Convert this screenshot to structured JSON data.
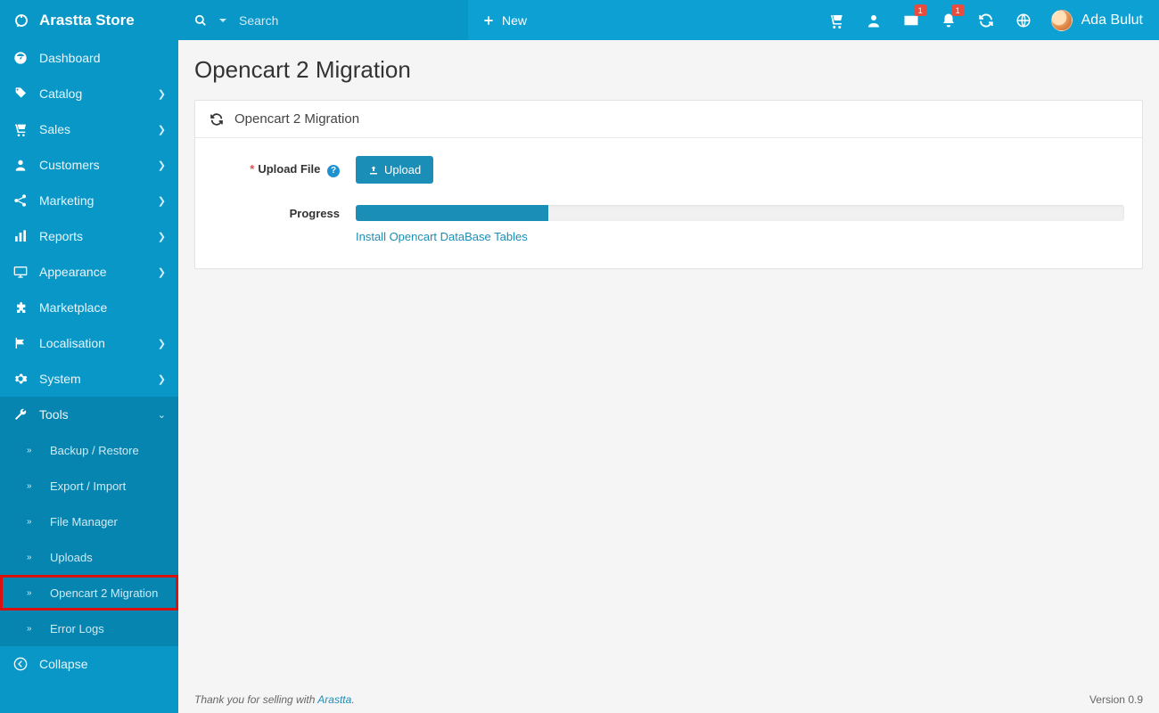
{
  "brand": {
    "name": "Arastta Store"
  },
  "search": {
    "placeholder": "Search"
  },
  "new_button": {
    "label": "New"
  },
  "topbar": {
    "envelope_badge": "1",
    "bell_badge": "1",
    "user_name": "Ada Bulut"
  },
  "sidebar": {
    "items": [
      {
        "label": "Dashboard"
      },
      {
        "label": "Catalog"
      },
      {
        "label": "Sales"
      },
      {
        "label": "Customers"
      },
      {
        "label": "Marketing"
      },
      {
        "label": "Reports"
      },
      {
        "label": "Appearance"
      },
      {
        "label": "Marketplace"
      },
      {
        "label": "Localisation"
      },
      {
        "label": "System"
      },
      {
        "label": "Tools"
      }
    ],
    "tools_sub": [
      {
        "label": "Backup / Restore"
      },
      {
        "label": "Export / Import"
      },
      {
        "label": "File Manager"
      },
      {
        "label": "Uploads"
      },
      {
        "label": "Opencart 2 Migration"
      },
      {
        "label": "Error Logs"
      }
    ],
    "collapse_label": "Collapse"
  },
  "page": {
    "title": "Opencart 2 Migration",
    "panel_title": "Opencart 2 Migration",
    "upload_label": "Upload File",
    "upload_button": "Upload",
    "progress_label": "Progress",
    "progress_percent": 25,
    "progress_status": "Install Opencart DataBase Tables"
  },
  "footer": {
    "thank_prefix": "Thank you for selling with ",
    "thank_link": "Arastta",
    "thank_suffix": ".",
    "version": "Version 0.9"
  }
}
